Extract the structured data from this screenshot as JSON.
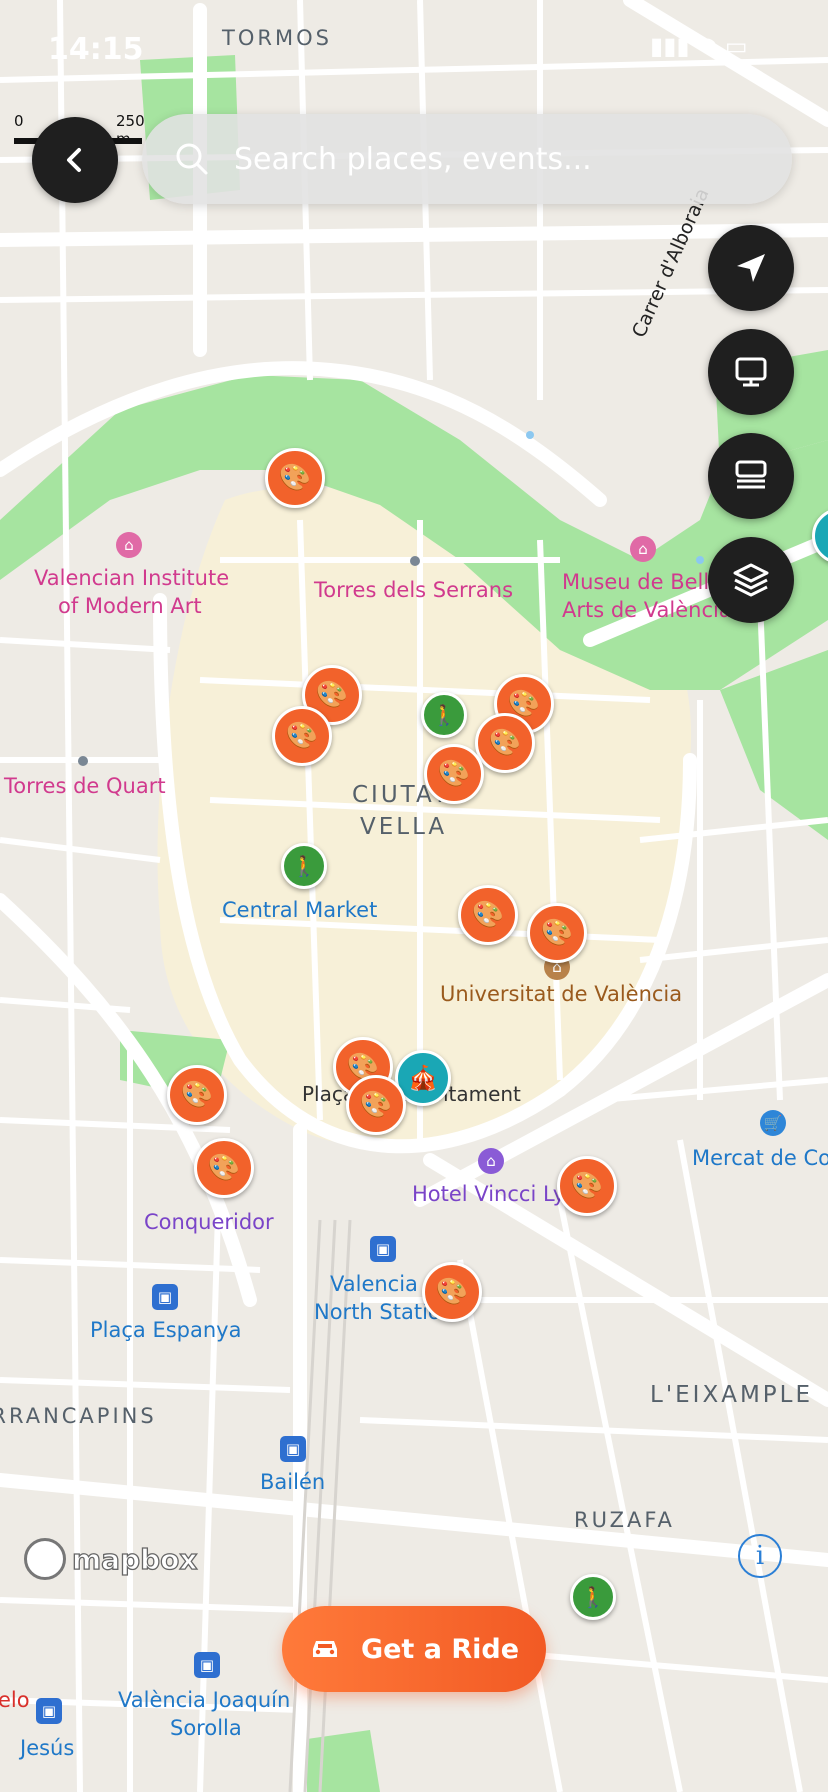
{
  "status_bar": {
    "time": "14:15"
  },
  "scale": {
    "zero": "0",
    "distance": "250 m"
  },
  "search": {
    "placeholder": "Search places, events..."
  },
  "map_labels": {
    "tormos": "TORMOS",
    "carrer_alboraia": "Carrer d'Alboraia",
    "valencian_institute": "Valencian Institute",
    "of_modern_art": "of Modern Art",
    "torres_serrans": "Torres dels Serrans",
    "museu_line1": "Museu de Belles",
    "museu_line2": "Arts de València",
    "torres_quart": "Torres de Quart",
    "ciutat": "CIUTAT",
    "vella": "VELLA",
    "central_market": "Central Market",
    "universitat": "Universitat de València",
    "placa_ajuntament": "Plaça de l'Ajuntament",
    "mercat_colon": "Mercat de Colón",
    "hotel_vincci": "Hotel Vincci Lys",
    "conqueridor": "Conqueridor",
    "valencia_north_1": "Valencia",
    "valencia_north_2": "North Station",
    "placa_espanya": "Plaça Espanya",
    "arrancapins": "ARRANCAPINS",
    "eixample": "L'EIXAMPLE",
    "bailen": "Bailén",
    "ruzafa": "RUZAFA",
    "joaquin_1": "València Joaquín",
    "joaquin_2": "Sorolla",
    "jesus": "Jesús",
    "melo": "elo"
  },
  "markers": {
    "art": "🎨",
    "walk": "🚶",
    "circus": "🎪"
  },
  "attribution": {
    "brand": "mapbox",
    "info": "i"
  },
  "actions": {
    "ride_label": "Get a Ride"
  },
  "colors": {
    "accent": "#f2622b",
    "park": "#a6e4a0",
    "road": "#ffffff"
  }
}
